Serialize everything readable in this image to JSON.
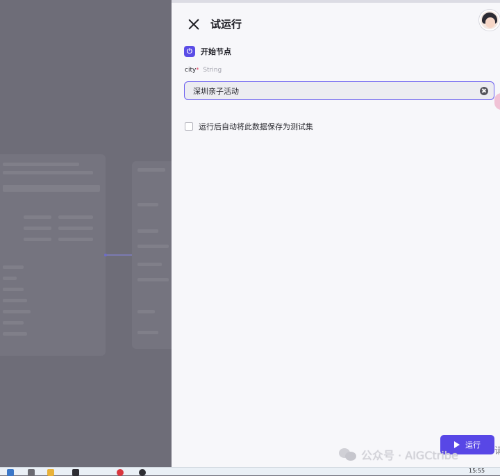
{
  "panel": {
    "title": "试运行",
    "node_title": "开始节点",
    "param": {
      "name": "city",
      "required_mark": "*",
      "type": "String",
      "value": "深圳亲子活动"
    },
    "save_option_label": "运行后自动将此数据保存为测试集",
    "run_button_label": "运行",
    "edge_char": "请"
  },
  "watermark": {
    "text": "公众号 · AIGCtribe"
  },
  "taskbar": {
    "clock": "15:55"
  },
  "colors": {
    "accent": "#5847e6",
    "panel_bg": "#f7f7fa",
    "overlay": "#6e6d78"
  }
}
